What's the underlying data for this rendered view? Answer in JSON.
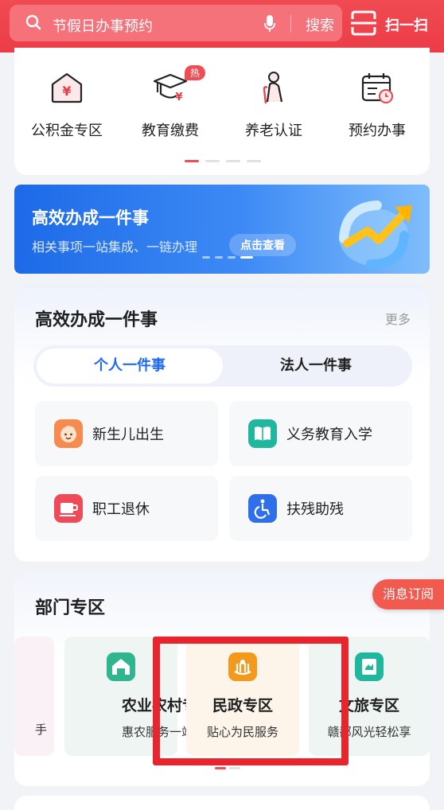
{
  "header": {
    "search_placeholder": "节假日办事预约",
    "search_button": "搜索",
    "scan_label": "扫一扫"
  },
  "quick_tools": {
    "items": [
      {
        "label": "公积金专区",
        "icon": "housing-fund-icon"
      },
      {
        "label": "教育缴费",
        "icon": "graduation-cap-icon"
      },
      {
        "label": "养老认证",
        "icon": "elderly-icon"
      },
      {
        "label": "预约办事",
        "icon": "calendar-clock-icon"
      }
    ],
    "hot_badge": "热"
  },
  "banner": {
    "title": "高效办成一件事",
    "subtitle": "相关事项一站集成、一链办理",
    "cta": "点击查看"
  },
  "efficient": {
    "title": "高效办成一件事",
    "more": "更多",
    "tabs": [
      {
        "label": "个人一件事",
        "active": true
      },
      {
        "label": "法人一件事",
        "active": false
      }
    ],
    "items": [
      {
        "label": "新生儿出生",
        "icon": "baby-icon",
        "color": "#f58b4e"
      },
      {
        "label": "义务教育入学",
        "icon": "book-icon",
        "color": "#1fb89e"
      },
      {
        "label": "职工退休",
        "icon": "cup-icon",
        "color": "#ee4a57"
      },
      {
        "label": "扶残助残",
        "icon": "wheelchair-icon",
        "color": "#2f6fe9"
      }
    ]
  },
  "department": {
    "title": "部门专区",
    "cards": [
      {
        "name": "",
        "desc": "手"
      },
      {
        "name": "农业农村专区",
        "desc": "惠农服务一站办",
        "color": "#2fb68f"
      },
      {
        "name": "民政专区",
        "desc": "贴心为民服务",
        "color": "#f39a1d"
      },
      {
        "name": "文旅专区",
        "desc": "赣鄱风光轻松享",
        "color": "#1fb89e"
      }
    ]
  },
  "floating": {
    "subscribe": "消息订阅"
  }
}
